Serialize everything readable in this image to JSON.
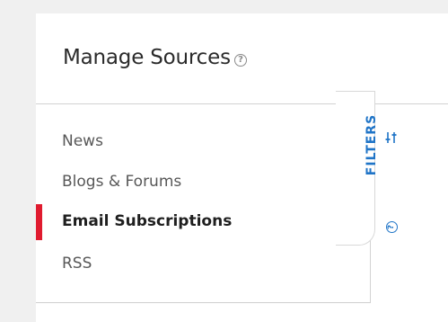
{
  "header": {
    "title": "Manage Sources",
    "help_glyph": "?"
  },
  "sidebar": {
    "items": [
      {
        "label": "News",
        "active": false
      },
      {
        "label": "Blogs & Forums",
        "active": false
      },
      {
        "label": "Email Subscriptions",
        "active": true
      },
      {
        "label": "RSS",
        "active": false
      }
    ]
  },
  "filters": {
    "label": "FILTERS",
    "icon": "sliders-icon",
    "help_icon": "question-circle-icon",
    "help_glyph": "?"
  },
  "colors": {
    "accent": "#1f74c7",
    "active_marker": "#e01b2f",
    "background": "#f0f0f0"
  }
}
